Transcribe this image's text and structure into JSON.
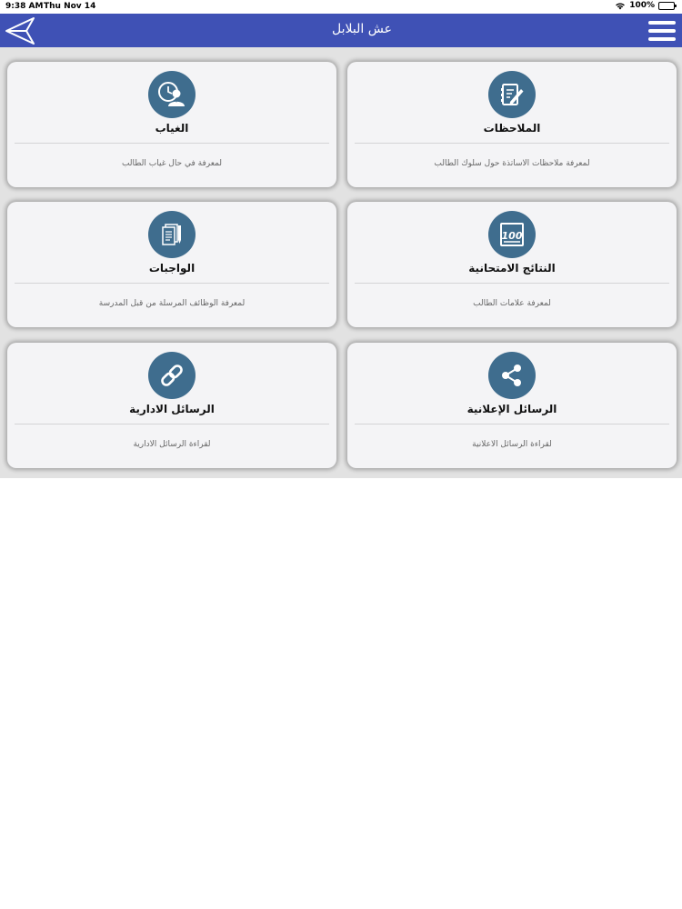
{
  "status": {
    "time": "9:38 AM",
    "date": "Thu Nov 14",
    "battery": "100%"
  },
  "navbar": {
    "title": "عش البلابل"
  },
  "cards": [
    {
      "title": "الملاحظات",
      "desc": "لمعرفة ملاحظات الاساتذة حول سلوك الطالب",
      "icon": "notes-icon"
    },
    {
      "title": "الغياب",
      "desc": "لمعرفة في حال غياب الطالب",
      "icon": "absence-icon"
    },
    {
      "title": "النتائج الامتحانية",
      "desc": "لمعرفة علامات الطالب",
      "icon": "exam-results-icon"
    },
    {
      "title": "الواجبات",
      "desc": "لمعرفة الوظائف المرسلة من قبل المدرسة",
      "icon": "homework-icon"
    },
    {
      "title": "الرسائل الإعلانية",
      "desc": "لقراءة الرسائل الاعلانية",
      "icon": "share-icon"
    },
    {
      "title": "الرسائل الادارية",
      "desc": "لقراءة الرسائل الادارية",
      "icon": "link-icon"
    }
  ],
  "colors": {
    "navbar": "#3f51b5",
    "icon_circle": "#3f6d8e",
    "background": "#e2e2e2",
    "card": "#f4f4f6"
  }
}
